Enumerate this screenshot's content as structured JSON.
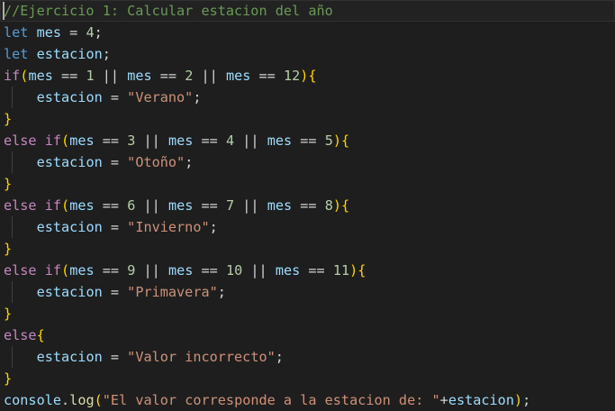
{
  "editor": {
    "lines": [
      [
        [
          "com",
          "//Ejercicio 1: Calcular estacion del año"
        ]
      ],
      [
        [
          "kw",
          "let"
        ],
        [
          "ws",
          " "
        ],
        [
          "var",
          "mes"
        ],
        [
          "op",
          " = "
        ],
        [
          "num",
          "4"
        ],
        [
          "op",
          ";"
        ]
      ],
      [
        [
          "kw",
          "let"
        ],
        [
          "ws",
          " "
        ],
        [
          "var",
          "estacion"
        ],
        [
          "op",
          ";"
        ]
      ],
      [
        [
          "ctl",
          "if"
        ],
        [
          "br1",
          "("
        ],
        [
          "var",
          "mes"
        ],
        [
          "op",
          " == "
        ],
        [
          "num",
          "1"
        ],
        [
          "op",
          " || "
        ],
        [
          "var",
          "mes"
        ],
        [
          "op",
          " == "
        ],
        [
          "num",
          "2"
        ],
        [
          "op",
          " || "
        ],
        [
          "var",
          "mes"
        ],
        [
          "op",
          " == "
        ],
        [
          "num",
          "12"
        ],
        [
          "br1",
          ")"
        ],
        [
          "br1",
          "{"
        ]
      ],
      [
        [
          "ws",
          "    "
        ],
        [
          "var",
          "estacion"
        ],
        [
          "op",
          " = "
        ],
        [
          "str",
          "\"Verano\""
        ],
        [
          "op",
          ";"
        ]
      ],
      [
        [
          "br1",
          "}"
        ]
      ],
      [
        [
          "ctl",
          "else"
        ],
        [
          "ws",
          " "
        ],
        [
          "ctl",
          "if"
        ],
        [
          "br1",
          "("
        ],
        [
          "var",
          "mes"
        ],
        [
          "op",
          " == "
        ],
        [
          "num",
          "3"
        ],
        [
          "op",
          " || "
        ],
        [
          "var",
          "mes"
        ],
        [
          "op",
          " == "
        ],
        [
          "num",
          "4"
        ],
        [
          "op",
          " || "
        ],
        [
          "var",
          "mes"
        ],
        [
          "op",
          " == "
        ],
        [
          "num",
          "5"
        ],
        [
          "br1",
          ")"
        ],
        [
          "br1",
          "{"
        ]
      ],
      [
        [
          "ws",
          "    "
        ],
        [
          "var",
          "estacion"
        ],
        [
          "op",
          " = "
        ],
        [
          "str",
          "\"Otoño\""
        ],
        [
          "op",
          ";"
        ]
      ],
      [
        [
          "br1",
          "}"
        ]
      ],
      [
        [
          "ctl",
          "else"
        ],
        [
          "ws",
          " "
        ],
        [
          "ctl",
          "if"
        ],
        [
          "br1",
          "("
        ],
        [
          "var",
          "mes"
        ],
        [
          "op",
          " == "
        ],
        [
          "num",
          "6"
        ],
        [
          "op",
          " || "
        ],
        [
          "var",
          "mes"
        ],
        [
          "op",
          " == "
        ],
        [
          "num",
          "7"
        ],
        [
          "op",
          " || "
        ],
        [
          "var",
          "mes"
        ],
        [
          "op",
          " == "
        ],
        [
          "num",
          "8"
        ],
        [
          "br1",
          ")"
        ],
        [
          "br1",
          "{"
        ]
      ],
      [
        [
          "ws",
          "    "
        ],
        [
          "var",
          "estacion"
        ],
        [
          "op",
          " = "
        ],
        [
          "str",
          "\"Invierno\""
        ],
        [
          "op",
          ";"
        ]
      ],
      [
        [
          "br1",
          "}"
        ]
      ],
      [
        [
          "ctl",
          "else"
        ],
        [
          "ws",
          " "
        ],
        [
          "ctl",
          "if"
        ],
        [
          "br1",
          "("
        ],
        [
          "var",
          "mes"
        ],
        [
          "op",
          " == "
        ],
        [
          "num",
          "9"
        ],
        [
          "op",
          " || "
        ],
        [
          "var",
          "mes"
        ],
        [
          "op",
          " == "
        ],
        [
          "num",
          "10"
        ],
        [
          "op",
          " || "
        ],
        [
          "var",
          "mes"
        ],
        [
          "op",
          " == "
        ],
        [
          "num",
          "11"
        ],
        [
          "br1",
          ")"
        ],
        [
          "br1",
          "{"
        ]
      ],
      [
        [
          "ws",
          "    "
        ],
        [
          "var",
          "estacion"
        ],
        [
          "op",
          " = "
        ],
        [
          "str",
          "\"Primavera\""
        ],
        [
          "op",
          ";"
        ]
      ],
      [
        [
          "br1",
          "}"
        ]
      ],
      [
        [
          "ctl",
          "else"
        ],
        [
          "br1",
          "{"
        ]
      ],
      [
        [
          "ws",
          "    "
        ],
        [
          "var",
          "estacion"
        ],
        [
          "op",
          " = "
        ],
        [
          "str",
          "\"Valor incorrecto\""
        ],
        [
          "op",
          ";"
        ]
      ],
      [
        [
          "br1",
          "}"
        ]
      ],
      [
        [
          "var",
          "console"
        ],
        [
          "op",
          "."
        ],
        [
          "fn",
          "log"
        ],
        [
          "br1",
          "("
        ],
        [
          "str",
          "\"El valor corresponde a la estacion de: \""
        ],
        [
          "op",
          "+"
        ],
        [
          "var",
          "estacion"
        ],
        [
          "br1",
          ")"
        ],
        [
          "op",
          ";"
        ]
      ]
    ]
  }
}
